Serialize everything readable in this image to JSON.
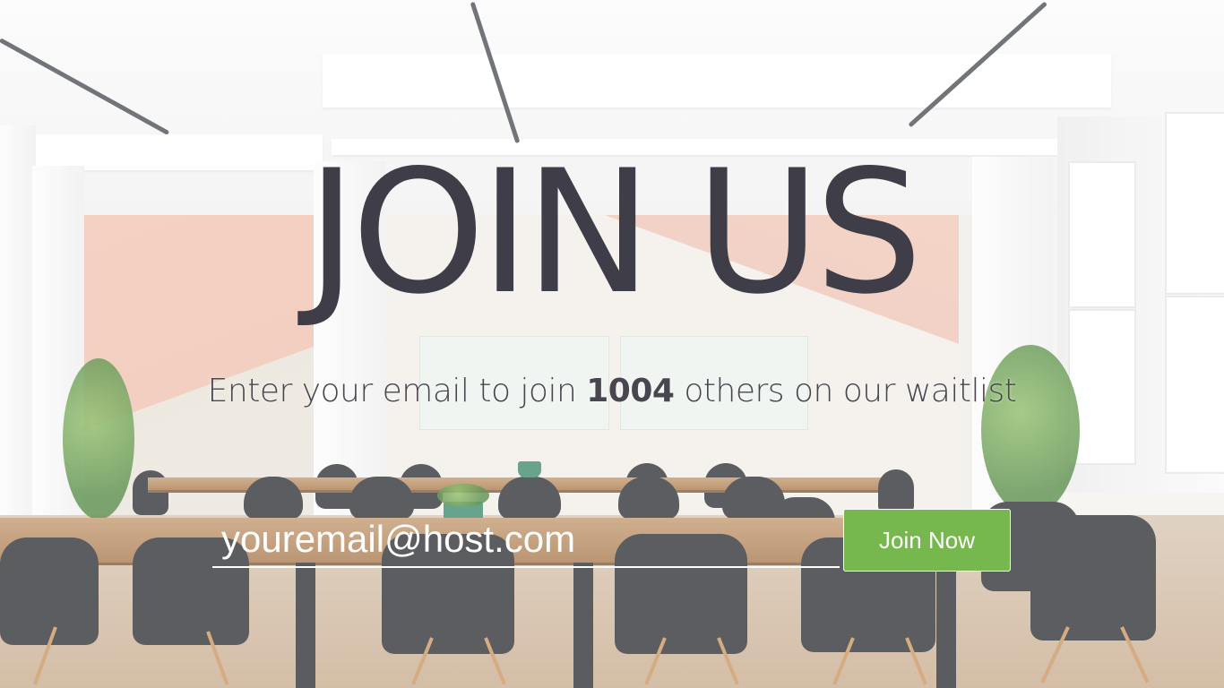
{
  "hero": {
    "title": "JOIN US",
    "subtitle_before": "Enter your email to join ",
    "subtitle_count": "1004",
    "subtitle_after": " others on our waitlist"
  },
  "form": {
    "email_placeholder": "youremail@host.com",
    "submit_label": "Join Now"
  },
  "colors": {
    "title": "#3f3e48",
    "button": "#76b74e",
    "input_underline": "#ffffff"
  }
}
